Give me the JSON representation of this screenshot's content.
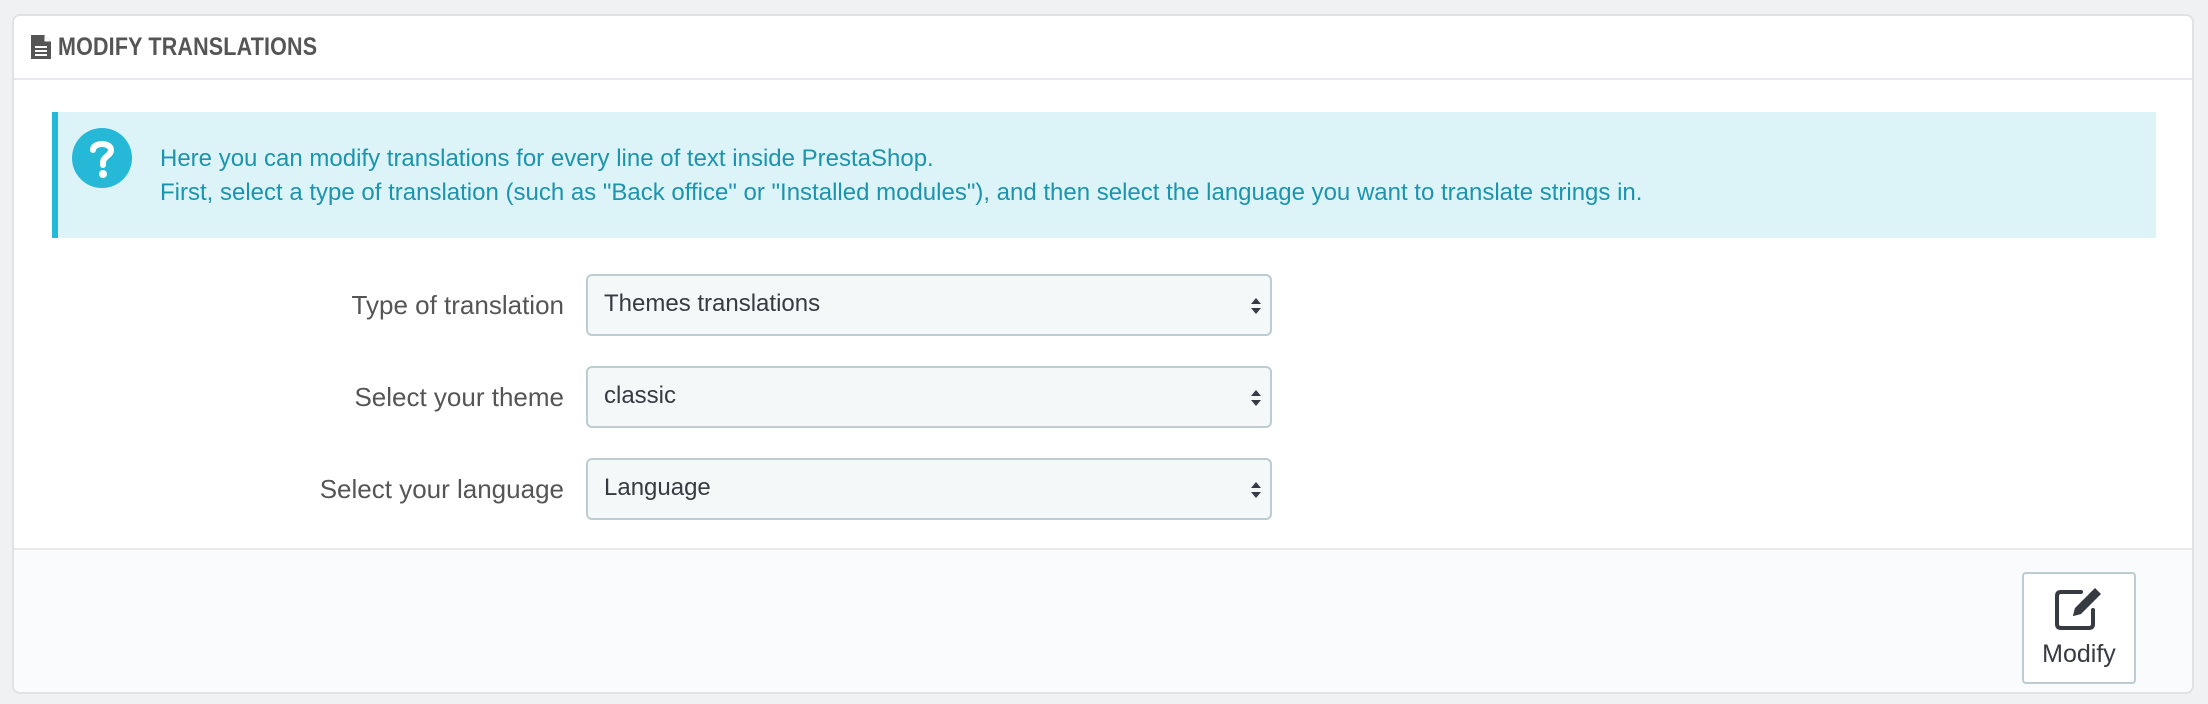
{
  "panel": {
    "title": "MODIFY TRANSLATIONS",
    "heading_icon": "file-text-icon"
  },
  "alert": {
    "icon": "question-circle-icon",
    "line1": "Here you can modify translations for every line of text inside PrestaShop.",
    "line2": "First, select a type of translation (such as \"Back office\" or \"Installed modules\"), and then select the language you want to translate strings in."
  },
  "form": {
    "type_label": "Type of translation",
    "type_value": "Themes translations",
    "theme_label": "Select your theme",
    "theme_value": "classic",
    "language_label": "Select your language",
    "language_value": "Language"
  },
  "footer": {
    "modify_label": "Modify",
    "modify_icon": "edit-icon"
  },
  "colors": {
    "alert_bg": "#dcf3f8",
    "alert_accent": "#25b9d7",
    "alert_text": "#1c94ad"
  }
}
